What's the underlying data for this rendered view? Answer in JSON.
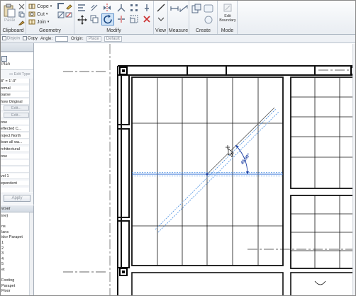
{
  "ribbon": {
    "clipboard": {
      "label": "Clipboard",
      "paste": "Paste"
    },
    "geometry": {
      "label": "Geometry",
      "cope": "Cope",
      "cut": "Cut",
      "join": "Join"
    },
    "modify": {
      "label": "Modify"
    },
    "view": {
      "label": "View"
    },
    "measure": {
      "label": "Measure"
    },
    "create": {
      "label": "Create"
    },
    "mode": {
      "label": "Mode",
      "edit_boundary": "Edit\nBoundary"
    }
  },
  "options_bar": {
    "disjoin": "Disjoin",
    "copy": "Copy",
    "angle_label": "Angle:",
    "angle_value": "",
    "origin_label": "Origin:",
    "place": "Place",
    "default": "Default"
  },
  "properties": {
    "type_name": "Plan",
    "edit_type": "Edit Type",
    "rows": [
      {
        "text": "8\" = 1'-0\"",
        "kind": "value"
      },
      {
        "text": "ormal",
        "kind": "value"
      },
      {
        "text": "oarse",
        "kind": "value"
      },
      {
        "text": "how Original",
        "kind": "value"
      },
      {
        "text": "Edit...",
        "kind": "button"
      },
      {
        "text": "Edit...",
        "kind": "button"
      },
      {
        "text": "one",
        "kind": "value"
      },
      {
        "text": "eflected C...",
        "kind": "value"
      },
      {
        "text": "roject North",
        "kind": "value"
      },
      {
        "text": "lean all wa...",
        "kind": "value"
      },
      {
        "text": "rchitectural",
        "kind": "value"
      },
      {
        "text": "one",
        "kind": "value"
      },
      {
        "text": "",
        "kind": "value"
      },
      {
        "text": "",
        "kind": "value"
      },
      {
        "text": "vel 1",
        "kind": "value"
      },
      {
        "text": "ependent",
        "kind": "value"
      },
      {
        "text": "",
        "kind": "value"
      }
    ],
    "apply": "Apply"
  },
  "browser": {
    "header": "wser",
    "items": [
      "ine)",
      "",
      "ns",
      "lans",
      "idor Parapet",
      "1",
      "2",
      "3",
      "4",
      "5",
      "et",
      "",
      "Footing",
      "Parapet",
      "Floor"
    ]
  },
  "canvas": {
    "angle_readout": "45.00°"
  },
  "colors": {
    "ribbon_top": "#fbfcfd",
    "ribbon_bottom": "#e9edf2",
    "dimension_blue": "#1d3fa3",
    "selection_blue": "#4a90e2"
  }
}
